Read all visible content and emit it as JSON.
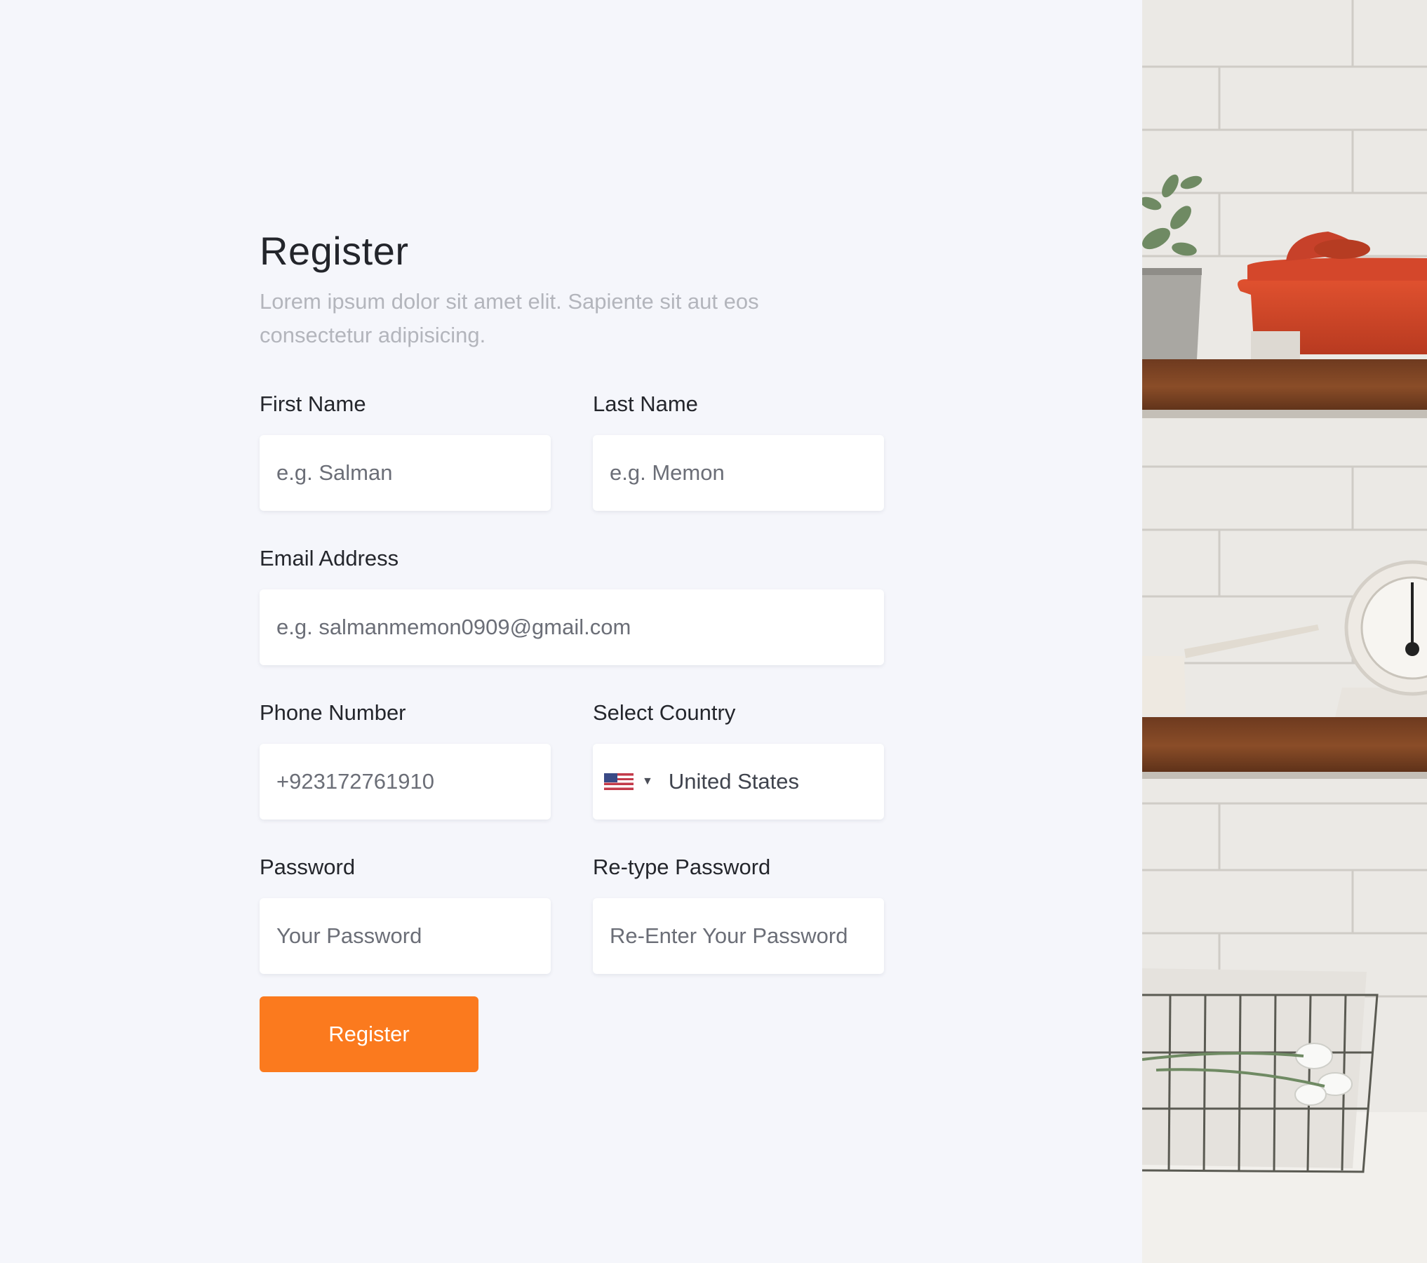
{
  "form": {
    "title": "Register",
    "subtitle": "Lorem ipsum dolor sit amet elit. Sapiente sit aut eos consectetur adipisicing.",
    "first_name": {
      "label": "First Name",
      "placeholder": "e.g. Salman"
    },
    "last_name": {
      "label": "Last Name",
      "placeholder": "e.g. Memon"
    },
    "email": {
      "label": "Email Address",
      "placeholder": "e.g. salmanmemon0909@gmail.com"
    },
    "phone": {
      "label": "Phone Number",
      "placeholder": "+923172761910"
    },
    "country": {
      "label": "Select Country",
      "value": "United States",
      "flag_icon": "us-flag-icon",
      "dropdown_icon": "caret-down-icon"
    },
    "password": {
      "label": "Password",
      "placeholder": "Your Password"
    },
    "retype_password": {
      "label": "Re-type Password",
      "placeholder": "Re-Enter Your Password"
    },
    "submit_label": "Register"
  },
  "colors": {
    "background": "#f5f6fb",
    "accent": "#fb7a1e",
    "title_text": "#23252b",
    "subtitle_text": "#b3b5bc",
    "input_background": "#ffffff"
  }
}
